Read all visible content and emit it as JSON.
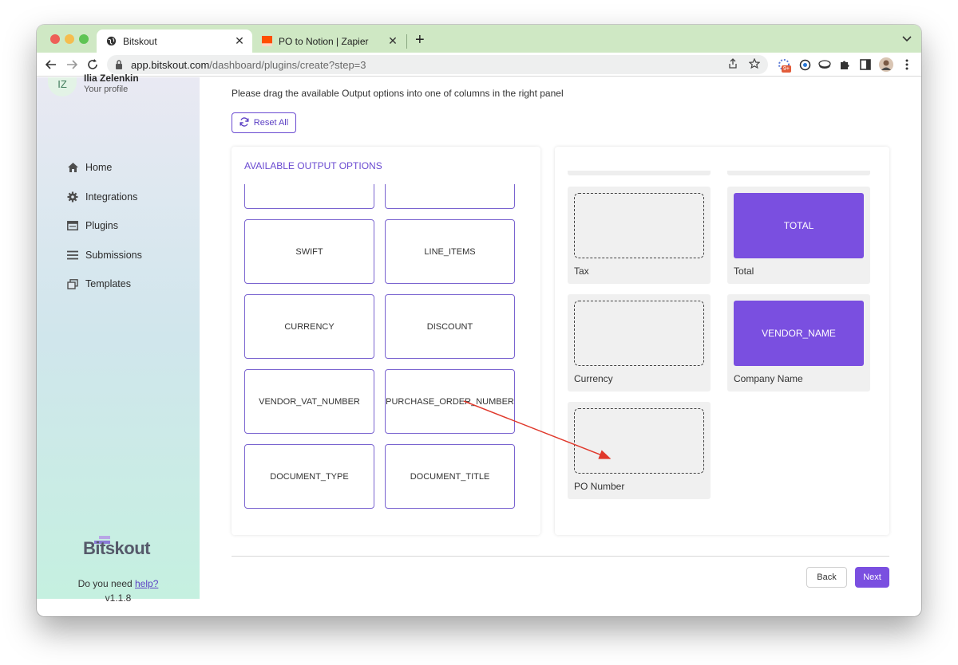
{
  "browser": {
    "tabs": [
      {
        "title": "Bitskout",
        "active": true
      },
      {
        "title": "PO to Notion | Zapier",
        "active": false
      }
    ],
    "url_host": "app.bitskout.com",
    "url_path": "/dashboard/plugins/create?step=3",
    "extension_badge": "9+"
  },
  "profile": {
    "initials": "IZ",
    "name": "Ilia Zelenkin",
    "subtitle": "Your profile"
  },
  "sidebar": {
    "items": [
      {
        "label": "Home",
        "icon": "home-icon"
      },
      {
        "label": "Integrations",
        "icon": "gear-icon"
      },
      {
        "label": "Plugins",
        "icon": "plugin-icon"
      },
      {
        "label": "Submissions",
        "icon": "list-icon"
      },
      {
        "label": "Templates",
        "icon": "templates-icon"
      }
    ],
    "logo_text": "Bitskout",
    "help_prefix": "Do you need ",
    "help_link": "help?",
    "version": "v1.1.8"
  },
  "main": {
    "instruction": "Please drag the available Output options into one of columns in the right panel",
    "reset_label": "Reset All",
    "available_title": "AVAILABLE OUTPUT OPTIONS",
    "options": [
      "SWIFT",
      "LINE_ITEMS",
      "CURRENCY",
      "DISCOUNT",
      "VENDOR_VAT_NUMBER",
      "PURCHASE_ORDER_NUMBER",
      "DOCUMENT_TYPE",
      "DOCUMENT_TITLE"
    ],
    "columns": [
      {
        "label": "Tax",
        "value": ""
      },
      {
        "label": "Total",
        "value": "TOTAL"
      },
      {
        "label": "Currency",
        "value": ""
      },
      {
        "label": "Company Name",
        "value": "VENDOR_NAME"
      },
      {
        "label": "PO Number",
        "value": ""
      }
    ],
    "back_label": "Back",
    "next_label": "Next"
  },
  "colors": {
    "accent": "#7a4fe0",
    "tabbar": "#cfe8c4",
    "chat": "#2bb673",
    "arrow": "#e0382b"
  }
}
